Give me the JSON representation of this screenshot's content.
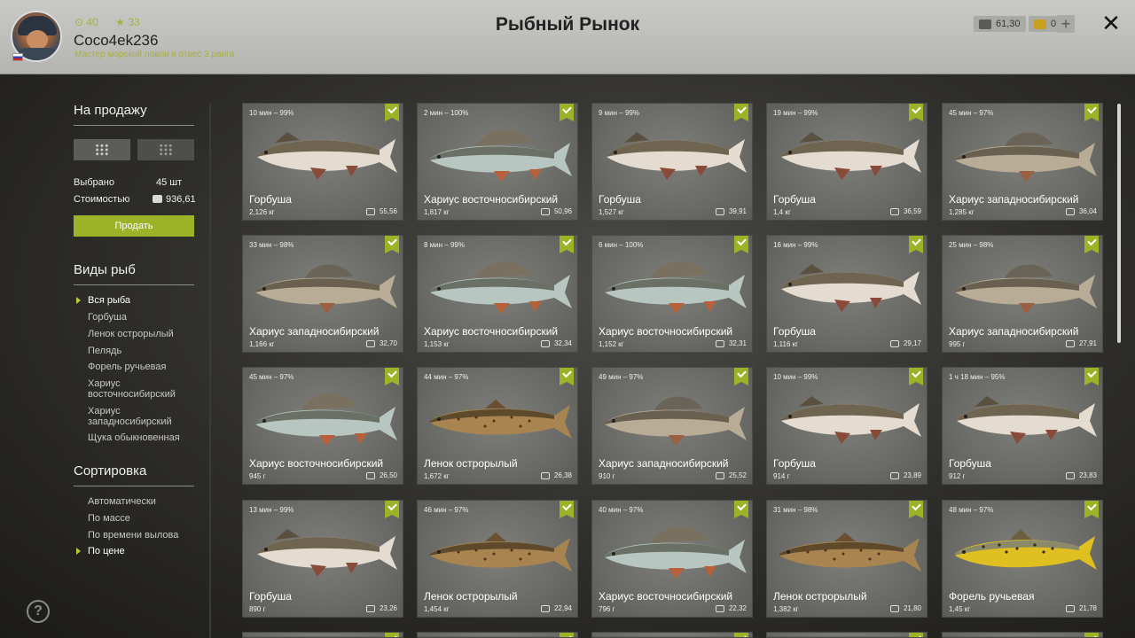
{
  "header": {
    "title": "Рыбный Рынок",
    "username": "Coco4ek236",
    "rank_text": "Мастер морской ловли в отвес 3 ранга",
    "stat_level": "40",
    "stat_stars": "33",
    "silver": "61,30",
    "gold": "0",
    "plus": "+",
    "close": "✕"
  },
  "sale": {
    "heading": "На продажу",
    "selected_label": "Выбрано",
    "selected_value": "45 шт",
    "cost_label": "Стоимостью",
    "cost_value": "936,61",
    "sell_button": "Продать"
  },
  "species": {
    "heading": "Виды рыб",
    "items": [
      "Вся рыба",
      "Горбуша",
      "Ленок острорылый",
      "Пелядь",
      "Форель ручьевая",
      "Хариус восточносибирский",
      "Хариус западносибирский",
      "Щука обыкновенная"
    ]
  },
  "sort": {
    "heading": "Сортировка",
    "items": [
      "Автоматически",
      "По массе",
      "По времени вылова",
      "По цене"
    ]
  },
  "help": "?",
  "colors": {
    "accent": "#9cb327",
    "stat": "#a8b23a"
  },
  "cards": [
    {
      "time": "10 мин – 99%",
      "name": "Горбуша",
      "weight": "2,126 кг",
      "price": "55,56",
      "fish": "pink"
    },
    {
      "time": "2 мин – 100%",
      "name": "Хариус восточносибирский",
      "weight": "1,817 кг",
      "price": "50,96",
      "fish": "grayling-east"
    },
    {
      "time": "9 мин – 99%",
      "name": "Горбуша",
      "weight": "1,527 кг",
      "price": "39,91",
      "fish": "pink"
    },
    {
      "time": "19 мин – 99%",
      "name": "Горбуша",
      "weight": "1,4 кг",
      "price": "36,59",
      "fish": "pink"
    },
    {
      "time": "45 мин – 97%",
      "name": "Хариус западносибирский",
      "weight": "1,285 кг",
      "price": "36,04",
      "fish": "grayling-west"
    },
    {
      "time": "33 мин – 98%",
      "name": "Хариус западносибирский",
      "weight": "1,166 кг",
      "price": "32,70",
      "fish": "grayling-west"
    },
    {
      "time": "8 мин – 99%",
      "name": "Хариус восточносибирский",
      "weight": "1,153 кг",
      "price": "32,34",
      "fish": "grayling-east"
    },
    {
      "time": "6 мин – 100%",
      "name": "Хариус восточносибирский",
      "weight": "1,152 кг",
      "price": "32,31",
      "fish": "grayling-east"
    },
    {
      "time": "16 мин – 99%",
      "name": "Горбуша",
      "weight": "1,116 кг",
      "price": "29,17",
      "fish": "pink"
    },
    {
      "time": "25 мин – 98%",
      "name": "Хариус западносибирский",
      "weight": "995 г",
      "price": "27,91",
      "fish": "grayling-west"
    },
    {
      "time": "45 мин – 97%",
      "name": "Хариус восточносибирский",
      "weight": "945 г",
      "price": "26,50",
      "fish": "grayling-east"
    },
    {
      "time": "44 мин – 97%",
      "name": "Ленок острорылый",
      "weight": "1,672 кг",
      "price": "26,38",
      "fish": "lenok"
    },
    {
      "time": "49 мин – 97%",
      "name": "Хариус западносибирский",
      "weight": "910 г",
      "price": "25,52",
      "fish": "grayling-west"
    },
    {
      "time": "10 мин – 99%",
      "name": "Горбуша",
      "weight": "914 г",
      "price": "23,89",
      "fish": "pink"
    },
    {
      "time": "1 ч 18 мин – 95%",
      "name": "Горбуша",
      "weight": "912 г",
      "price": "23,83",
      "fish": "pink"
    },
    {
      "time": "13 мин – 99%",
      "name": "Горбуша",
      "weight": "890 г",
      "price": "23,26",
      "fish": "pink"
    },
    {
      "time": "46 мин – 97%",
      "name": "Ленок острорылый",
      "weight": "1,454 кг",
      "price": "22,94",
      "fish": "lenok"
    },
    {
      "time": "40 мин – 97%",
      "name": "Хариус восточносибирский",
      "weight": "796 г",
      "price": "22,32",
      "fish": "grayling-east"
    },
    {
      "time": "31 мин – 98%",
      "name": "Ленок острорылый",
      "weight": "1,382 кг",
      "price": "21,80",
      "fish": "lenok"
    },
    {
      "time": "48 мин – 97%",
      "name": "Форель ручьевая",
      "weight": "1,45 кг",
      "price": "21,78",
      "fish": "trout"
    }
  ]
}
